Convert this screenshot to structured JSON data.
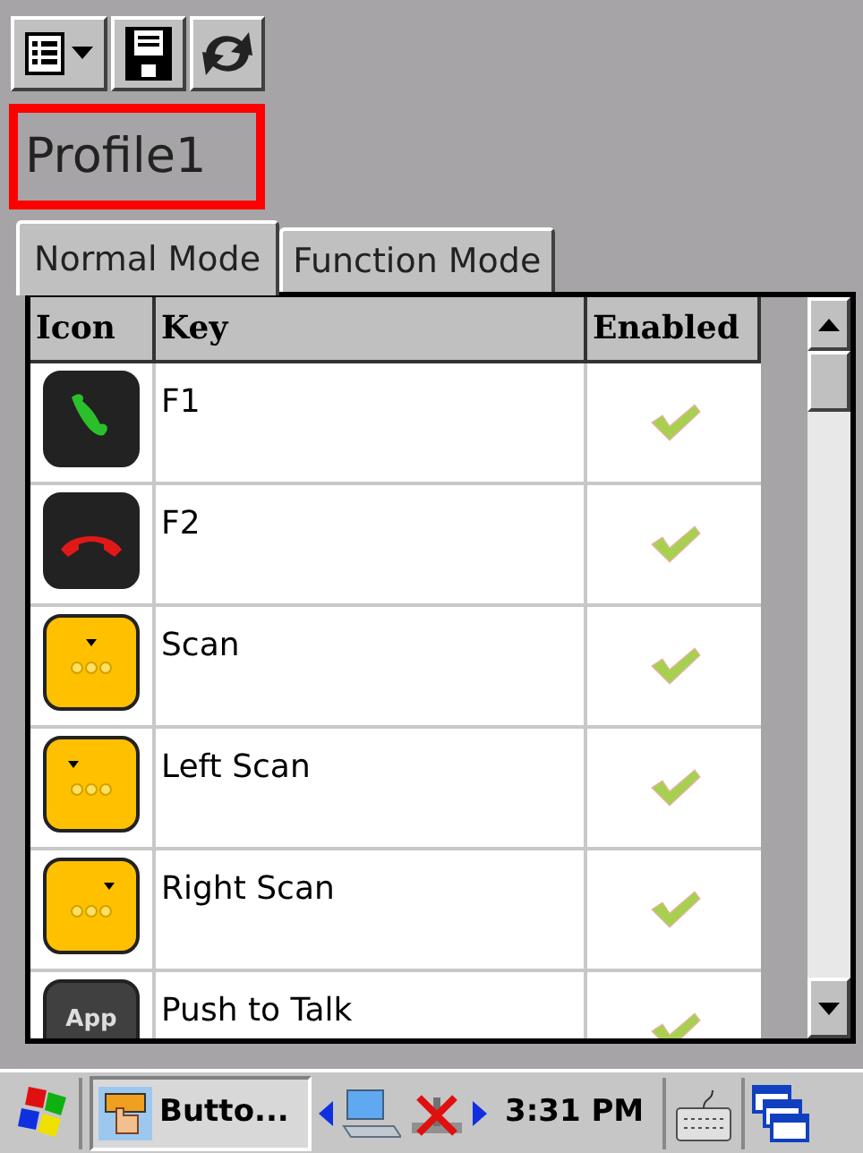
{
  "profile": {
    "name": "Profile1"
  },
  "tabs": [
    {
      "label": "Normal Mode",
      "selected": true
    },
    {
      "label": "Function Mode",
      "selected": false
    }
  ],
  "table": {
    "columns": [
      "Icon",
      "Key",
      "Enabled"
    ],
    "rows": [
      {
        "kind": "call",
        "key": "F1",
        "enabled": true
      },
      {
        "kind": "hangup",
        "key": "F2",
        "enabled": true
      },
      {
        "kind": "scan",
        "key": "Scan",
        "enabled": true
      },
      {
        "kind": "leftscan",
        "key": "Left Scan",
        "enabled": true
      },
      {
        "kind": "rightscan",
        "key": "Right Scan",
        "enabled": true
      },
      {
        "kind": "app",
        "icon_text": "App",
        "key": "Push to Talk",
        "enabled": true
      }
    ]
  },
  "taskbar": {
    "task": "Butto...",
    "time": "3:31 PM"
  }
}
